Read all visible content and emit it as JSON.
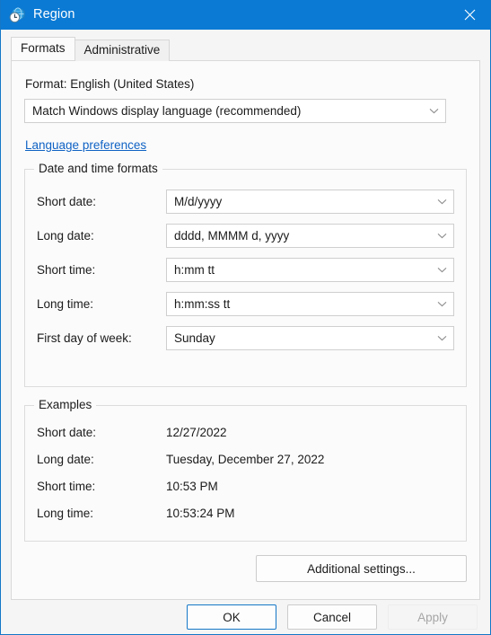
{
  "window": {
    "title": "Region",
    "icon": "region-globe-clock-icon",
    "close_label": "✕",
    "accent_color": "#0b7ad4"
  },
  "tabs": [
    {
      "label": "Formats",
      "selected": true
    },
    {
      "label": "Administrative",
      "selected": false
    }
  ],
  "formats": {
    "format_label": "Format: English (United States)",
    "format_combo_value": "Match Windows display language (recommended)",
    "language_preferences_link": "Language preferences",
    "datetime_group_legend": "Date and time formats",
    "fields": [
      {
        "label": "Short date:",
        "value": "M/d/yyyy"
      },
      {
        "label": "Long date:",
        "value": "dddd, MMMM d, yyyy"
      },
      {
        "label": "Short time:",
        "value": "h:mm tt"
      },
      {
        "label": "Long time:",
        "value": "h:mm:ss tt"
      },
      {
        "label": "First day of week:",
        "value": "Sunday"
      }
    ],
    "examples_group_legend": "Examples",
    "examples": [
      {
        "label": "Short date:",
        "value": "12/27/2022"
      },
      {
        "label": "Long date:",
        "value": "Tuesday, December 27, 2022"
      },
      {
        "label": "Short time:",
        "value": "10:53 PM"
      },
      {
        "label": "Long time:",
        "value": "10:53:24 PM"
      }
    ],
    "additional_settings_label": "Additional settings..."
  },
  "footer": {
    "ok_label": "OK",
    "cancel_label": "Cancel",
    "apply_label": "Apply",
    "apply_disabled": true
  }
}
